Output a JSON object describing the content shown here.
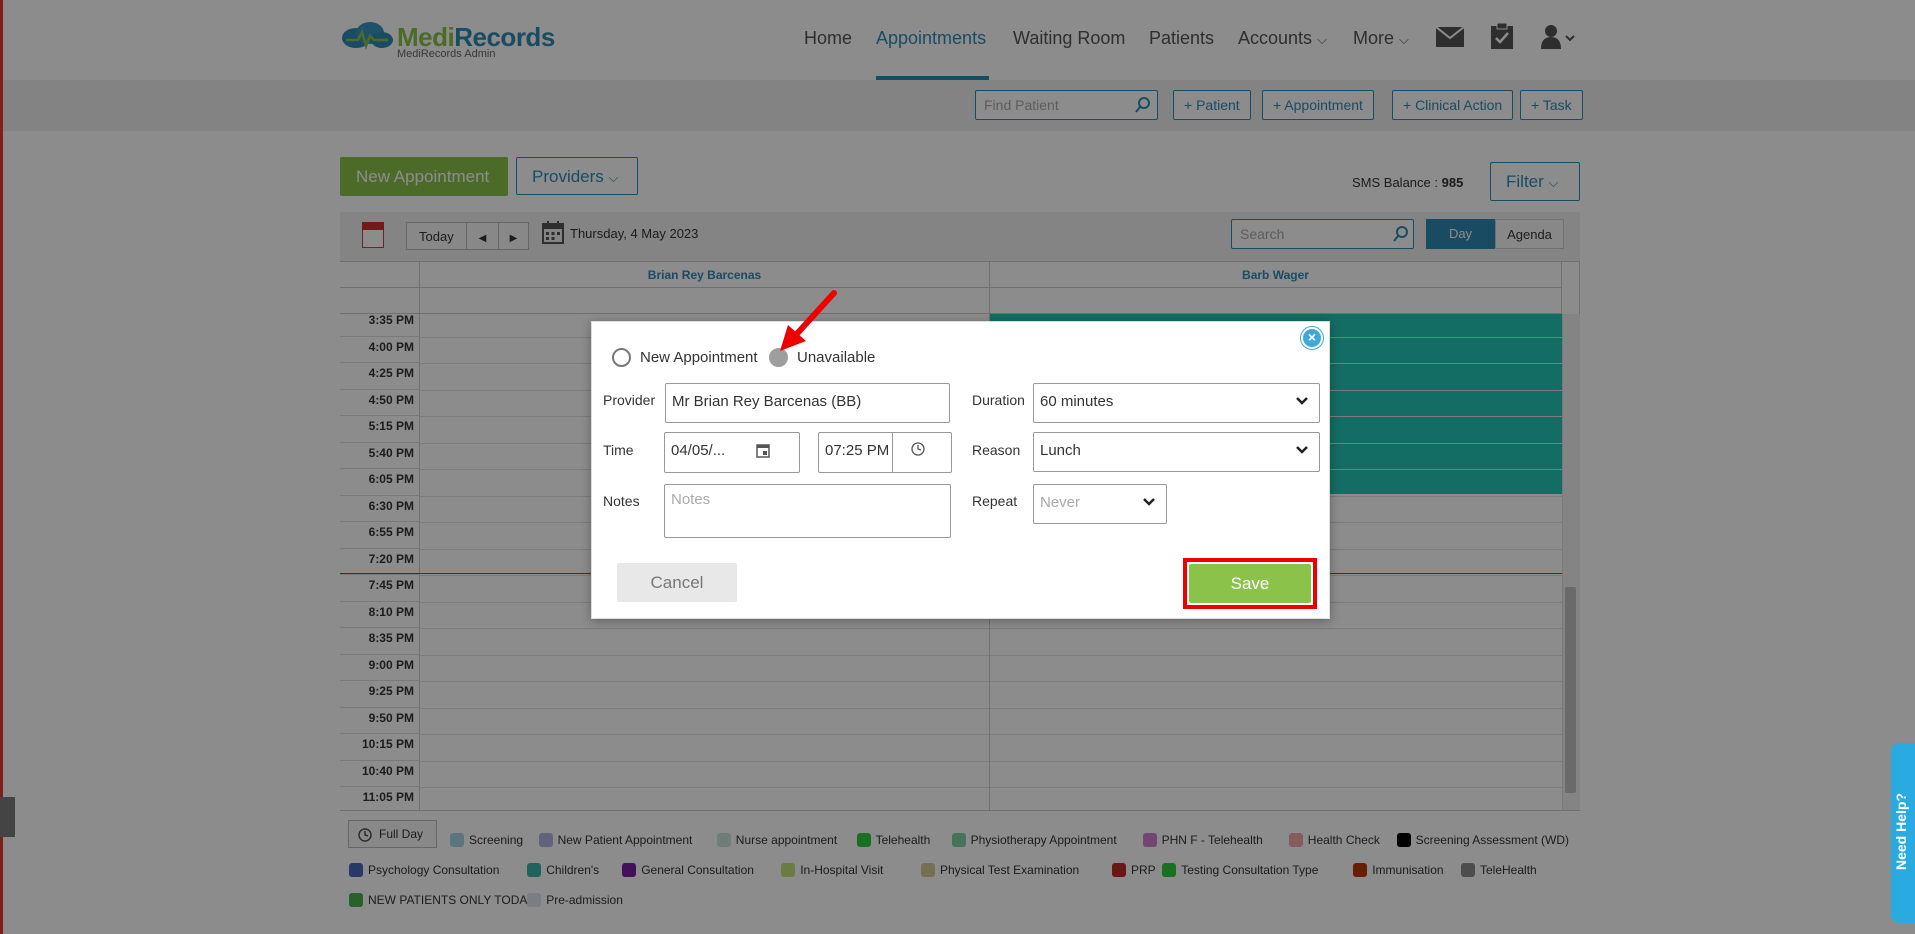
{
  "brand": {
    "name": "MediRecords",
    "sub": "MediRecords Admin",
    "color_green": "#8bc34a",
    "color_blue": "#2f8ab4"
  },
  "nav": {
    "items": [
      "Home",
      "Appointments",
      "Waiting Room",
      "Patients",
      "Accounts",
      "More"
    ],
    "active": "Appointments",
    "icons": [
      "mail-icon",
      "clipboard-check-icon",
      "user-icon"
    ]
  },
  "subbar": {
    "find_placeholder": "Find Patient",
    "buttons": [
      "+ Patient",
      "+ Appointment",
      "+ Clinical Action",
      "+ Task"
    ]
  },
  "actions": {
    "new_appointment": "New Appointment",
    "providers": "Providers",
    "sms_label": "SMS Balance :",
    "sms_value": "985",
    "filter": "Filter"
  },
  "calendar": {
    "today": "Today",
    "date": "Thursday, 4 May 2023",
    "search_placeholder": "Search",
    "view_day": "Day",
    "view_agenda": "Agenda",
    "columns": [
      "Brian Rey Barcenas",
      "Barb Wager"
    ],
    "times": [
      "3:35 PM",
      "4:00 PM",
      "4:25 PM",
      "4:50 PM",
      "5:15 PM",
      "5:40 PM",
      "6:05 PM",
      "6:30 PM",
      "6:55 PM",
      "7:20 PM",
      "7:45 PM",
      "8:10 PM",
      "8:35 PM",
      "9:00 PM",
      "9:25 PM",
      "9:50 PM",
      "10:15 PM",
      "10:40 PM",
      "11:05 PM"
    ]
  },
  "legend": {
    "full_day": "Full Day",
    "items": [
      {
        "label": "Screening",
        "color": "#a8d8ea"
      },
      {
        "label": "New Patient Appointment",
        "color": "#b3b3e6"
      },
      {
        "label": "Nurse appointment",
        "color": "#c7e6dd"
      },
      {
        "label": "Telehealth",
        "color": "#2ecc40"
      },
      {
        "label": "Physiotherapy Appointment",
        "color": "#7fd3a7"
      },
      {
        "label": "PHN F - Telehealth",
        "color": "#d07fd0"
      },
      {
        "label": "Health Check",
        "color": "#f4a6a6"
      },
      {
        "label": "Screening Assessment (WD)",
        "color": "#000000"
      },
      {
        "label": "Psychology Consultation",
        "color": "#4a69bd"
      },
      {
        "label": "Children's",
        "color": "#3cb3a8"
      },
      {
        "label": "General Consultation",
        "color": "#7b1fa2"
      },
      {
        "label": "In-Hospital Visit",
        "color": "#c5e17a"
      },
      {
        "label": "Physical Test Examination",
        "color": "#d6cc94"
      },
      {
        "label": "PRP",
        "color": "#c62828"
      },
      {
        "label": "Testing Consultation Type",
        "color": "#2ecc40"
      },
      {
        "label": "Immunisation",
        "color": "#bf360c"
      },
      {
        "label": "TeleHealth",
        "color": "#8c8c8c"
      },
      {
        "label": "NEW PATIENTS ONLY TODAY",
        "color": "#4caf50"
      },
      {
        "label": "Pre-admission",
        "color": "#dde3f0"
      }
    ]
  },
  "modal": {
    "radio_new": "New Appointment",
    "radio_unavailable": "Unavailable",
    "provider_label": "Provider",
    "provider_value": "Mr Brian Rey Barcenas (BB)",
    "duration_label": "Duration",
    "duration_value": "60 minutes",
    "time_label": "Time",
    "date_value": "04/05/...",
    "time_value": "07:25 PM",
    "reason_label": "Reason",
    "reason_value": "Lunch",
    "notes_label": "Notes",
    "notes_placeholder": "Notes",
    "repeat_label": "Repeat",
    "repeat_value": "Never",
    "cancel": "Cancel",
    "save": "Save"
  },
  "help": {
    "label": "Need Help?"
  }
}
